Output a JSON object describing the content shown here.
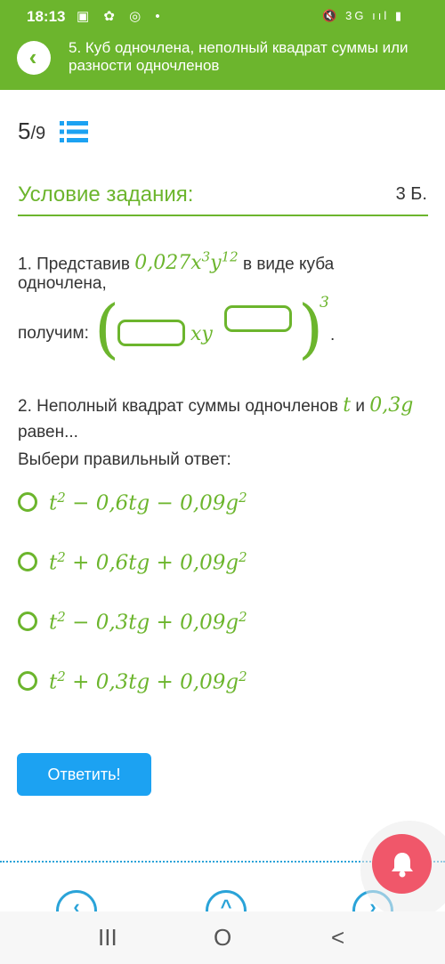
{
  "status_bar": {
    "time": "18:13",
    "icons_left": "▣ ✿ ◎ •",
    "icons_right": "🔇 3G ııl ▮"
  },
  "header": {
    "title": "5. Куб одночлена, неполный квадрат суммы или разности одночленов",
    "back_icon": "chevron-left-icon"
  },
  "progress": {
    "current": "5",
    "total": "/9"
  },
  "task": {
    "section_title": "Условие задания:",
    "points": "3 Б."
  },
  "question1": {
    "text_before": "1. Представив ",
    "expr_base": "0,027x",
    "expr_exp1": "3",
    "expr_var": "y",
    "expr_exp2": "12",
    "text_after": " в виде куба",
    "line2": "одночлена,",
    "answer_label": "получим:",
    "mid_var": "xy",
    "outer_exponent": "3",
    "period": "."
  },
  "question2": {
    "text_before": "2. Неполный квадрат суммы одночленов ",
    "var1": "t",
    "conj": " и ",
    "var2": "0,3g",
    "line2": "равен...",
    "instruction": "Выбери правильный ответ:"
  },
  "options": [
    {
      "base": "t",
      "exp": "2",
      "rest": " − 0,6tg − 0,09g",
      "exp2": "2"
    },
    {
      "base": "t",
      "exp": "2",
      "rest": " + 0,6tg + 0,09g",
      "exp2": "2"
    },
    {
      "base": "t",
      "exp": "2",
      "rest": " − 0,3tg + 0,09g",
      "exp2": "2"
    },
    {
      "base": "t",
      "exp": "2",
      "rest": " + 0,3tg + 0,09g",
      "exp2": "2"
    }
  ],
  "submit_label": "Ответить!",
  "bottom_nav": {
    "prev": "‹",
    "up": "^",
    "next": "›"
  },
  "android_nav": {
    "recents": "III",
    "home": "O",
    "back": "<"
  },
  "colors": {
    "brand_green": "#6cb52d",
    "button_blue": "#1ca2f2",
    "bell_red": "#f0576a",
    "nav_blue": "#2aa3d8"
  }
}
